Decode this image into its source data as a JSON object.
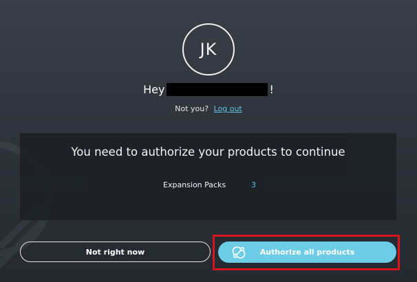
{
  "profile": {
    "initials": "JK",
    "greeting_prefix": "Hey",
    "greeting_suffix": "!",
    "not_you_text": "Not you?",
    "logout_label": "Log out"
  },
  "panel": {
    "title": "You need to authorize your products to continue",
    "item_label": "Expansion Packs",
    "item_count": "3"
  },
  "actions": {
    "secondary_label": "Not right now",
    "primary_label": "Authorize all products"
  },
  "icons": {
    "primary_icon": "authorize-link-icon"
  },
  "colors": {
    "accent": "#6dcde6",
    "link": "#5fc4e6",
    "highlight": "#d7151c",
    "panel_bg": "#1e2228"
  }
}
